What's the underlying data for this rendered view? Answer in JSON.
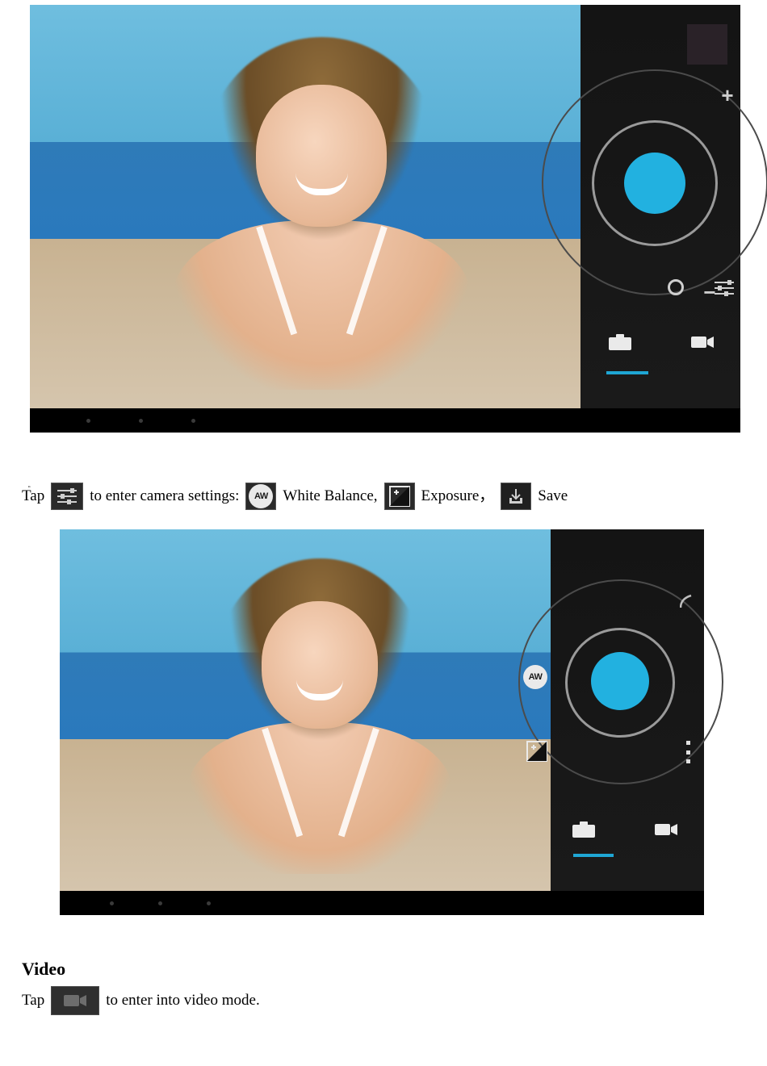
{
  "shot1": {
    "zoom_out_icon": "−",
    "zoom_in_icon": "+",
    "camera_mode_icon": "camera",
    "video_mode_icon": "video",
    "settings_icon": "sliders",
    "focus_icon": "ring",
    "shutter": "shutter",
    "thumbnail": "gallery-thumbnail",
    "active_mode": "camera"
  },
  "shot2": {
    "white_balance_icon": "AW",
    "exposure_icon": "exposure-compensation",
    "more_icon": "more-menu",
    "camera_mode_icon": "camera",
    "video_mode_icon": "video",
    "shutter": "shutter",
    "active_mode": "camera"
  },
  "settings_line": {
    "t1": "Tap",
    "t2": "to enter camera settings:",
    "wb": "White Balance,",
    "ex": "Exposure",
    "comma": "，",
    "save": "Save"
  },
  "video_section": {
    "heading": "Video",
    "t1": "Tap",
    "t2": "to enter into video mode."
  },
  "inline_icons": {
    "sliders": "sliders-icon",
    "aw": "AW",
    "exposure": "exposure-icon",
    "save": "save-icon",
    "video": "video-icon"
  },
  "colors": {
    "accent": "#1fa6d4",
    "shutter": "#22b1e0"
  }
}
